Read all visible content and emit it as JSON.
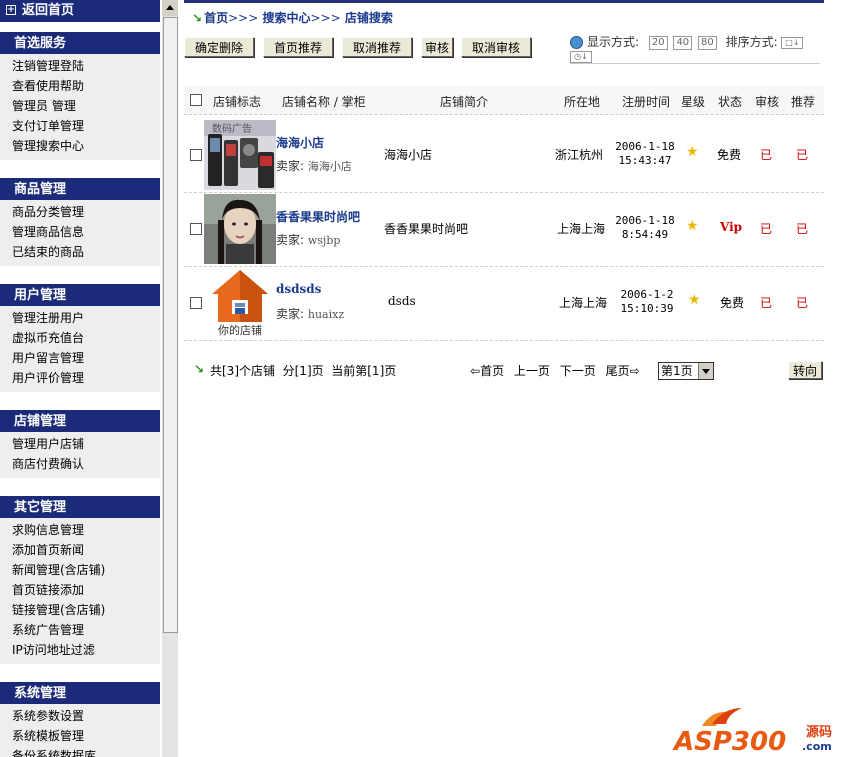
{
  "sidebar": {
    "home": "返回首页",
    "sections": [
      {
        "title": "首选服务",
        "items": [
          "注销管理登陆",
          "查看使用帮助",
          "管理员 管理",
          "支付订单管理",
          "管理搜索中心"
        ]
      },
      {
        "title": "商品管理",
        "items": [
          "商品分类管理",
          "管理商品信息",
          "已结束的商品"
        ]
      },
      {
        "title": "用户管理",
        "items": [
          "管理注册用户",
          "虚拟币充值台",
          "用户留言管理",
          "用户评价管理"
        ]
      },
      {
        "title": "店铺管理",
        "items": [
          "管理用户店铺",
          "商店付费确认"
        ]
      },
      {
        "title": "其它管理",
        "items": [
          "求购信息管理",
          "添加首页新闻",
          "新闻管理(含店铺)",
          "首页链接添加",
          "链接管理(含店铺)",
          "系统广告管理",
          "IP访问地址过滤"
        ]
      },
      {
        "title": "系统管理",
        "items": [
          "系统参数设置",
          "系统模板管理",
          "备份系统数据库"
        ]
      }
    ]
  },
  "breadcrumb": {
    "home": "首页",
    "sep": ">>>",
    "search": "搜索中心",
    "current": "店铺搜索"
  },
  "toolbar": {
    "buttons": [
      "确定删除",
      "首页推荐",
      "取消推荐",
      "审核",
      "取消审核"
    ]
  },
  "view": {
    "display_label": "显示方式:",
    "sizes": [
      "20",
      "40",
      "80"
    ],
    "sort_label": "排序方式:"
  },
  "table": {
    "headers": [
      "店铺标志",
      "店铺名称 / 掌柜",
      "店铺简介",
      "所在地",
      "注册时间",
      "星级",
      "状态",
      "审核",
      "推荐"
    ],
    "seller_label": "卖家:",
    "rows": [
      {
        "name": "海海小店",
        "seller": "海海小店",
        "intro": "海海小店",
        "location": "浙江杭州",
        "date": "2006-1-18",
        "time": "15:43:47",
        "status": "免费",
        "audit": "已",
        "recommend": "已",
        "logo": "phone-ad"
      },
      {
        "name": "香香果果时尚吧",
        "seller": "wsjbp",
        "intro": "香香果果时尚吧",
        "location": "上海上海",
        "date": "2006-1-18",
        "time": "8:54:49",
        "status": "Vip",
        "audit": "已",
        "recommend": "已",
        "logo": "portrait"
      },
      {
        "name": "dsdsds",
        "seller": "huaixz",
        "intro": "dsds",
        "location": "上海上海",
        "date": "2006-1-2",
        "time": "15:10:39",
        "status": "免费",
        "audit": "已",
        "recommend": "已",
        "logo": "your-shop",
        "logo_caption": "你的店铺"
      }
    ]
  },
  "pager": {
    "summary": "共[3]个店铺  分[1]页  当前第[1]页",
    "first": "首页",
    "prev": "上一页",
    "next": "下一页",
    "last": "尾页",
    "selected_page": "第1页",
    "go": "转向"
  },
  "watermark": {
    "brand": "ASP300",
    "suffix": "源码",
    "domain": ".com"
  },
  "colors": {
    "nav_header": "#1b2b7a",
    "nav_body": "#eeeeee",
    "link": "#1b3a8c",
    "accent_red": "#cc0000"
  }
}
